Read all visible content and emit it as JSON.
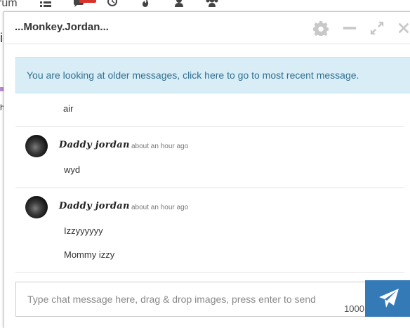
{
  "background": {
    "nav_partial_text": "rum",
    "side_char_1": "i",
    "side_char_2": "h",
    "badge_color": "#d9312b"
  },
  "chat": {
    "title": "...Monkey.Jordan...",
    "header_icons": [
      "gear-icon",
      "minimize-icon",
      "expand-icon",
      "close-icon"
    ],
    "notice": "You are looking at older messages, click here to go to most recent message.",
    "truncated_message": "air",
    "messages": [
      {
        "username": "Daddy jordan",
        "time": "about an hour ago",
        "lines": [
          "wyd"
        ]
      },
      {
        "username": "Daddy jordan",
        "time": "about an hour ago",
        "lines": [
          "Izzyyyyyy",
          "Mommy izzy"
        ]
      }
    ],
    "composer": {
      "placeholder": "Type chat message here, drag & drop images, press enter to send",
      "value": "",
      "char_limit": "1000"
    },
    "send_icon": "paper-plane-icon",
    "accent_color": "#337ab7",
    "notice_bg": "#d9edf7",
    "notice_text_color": "#31708f"
  }
}
